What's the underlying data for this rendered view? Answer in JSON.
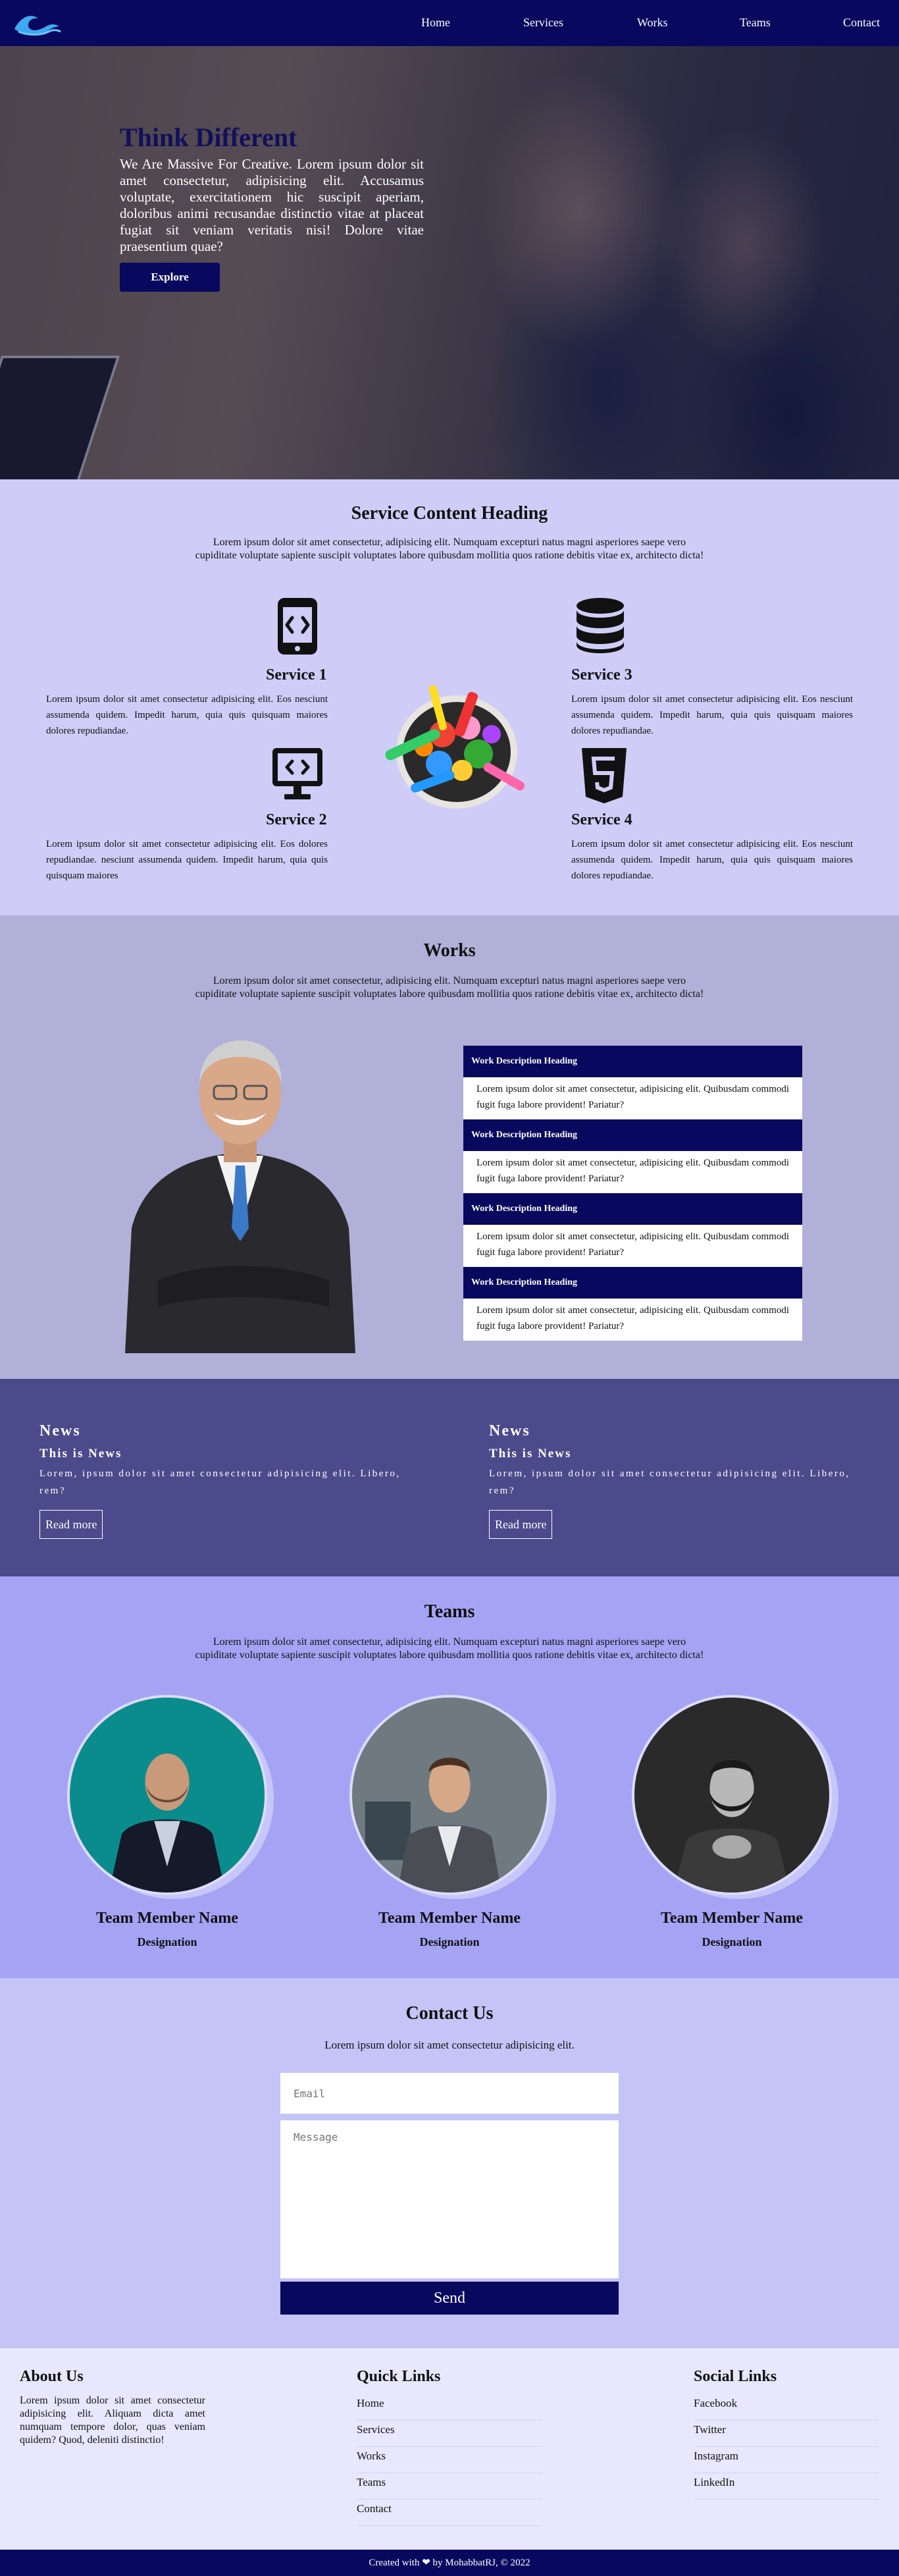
{
  "nav": {
    "items": [
      "Home",
      "Services",
      "Works",
      "Teams",
      "Contact"
    ]
  },
  "hero": {
    "title": "Think Different",
    "text": "We Are Massive For Creative. Lorem ipsum dolor sit amet consectetur, adipisicing elit. Accusamus voluptate, exercitationem hic suscipit aperiam, doloribus animi recusandae distinctio vitae at placeat fugiat sit veniam veritatis nisi! Dolore vitae praesentium quae?",
    "button": "Explore"
  },
  "services": {
    "title": "Service Content Heading",
    "subtitle": "Lorem ipsum dolor sit amet consectetur, adipisicing elit. Numquam excepturi natus magni asperiores saepe vero cupiditate voluptate sapiente suscipit voluptates labore quibusdam mollitia quos ratione debitis vitae ex, architecto dicta!",
    "items": [
      {
        "title": "Service 1",
        "text": "Lorem ipsum dolor sit amet consectetur adipisicing elit. Eos nesciunt assumenda quidem. Impedit harum, quia quis quisquam maiores dolores repudiandae.",
        "icon": "mobile-code-icon"
      },
      {
        "title": "Service 2",
        "text": "Lorem ipsum dolor sit amet consectetur adipisicing elit. Eos dolores repudiandae. nesciunt assumenda quidem. Impedit harum, quia quis quisquam maiores",
        "icon": "desktop-code-icon"
      },
      {
        "title": "Service 3",
        "text": "Lorem ipsum dolor sit amet consectetur adipisicing elit. Eos nesciunt assumenda quidem. Impedit harum, quia quis quisquam maiores dolores repudiandae.",
        "icon": "database-icon"
      },
      {
        "title": "Service 4",
        "text": "Lorem ipsum dolor sit amet consectetur adipisicing elit. Eos nesciunt assumenda quidem. Impedit harum, quia quis quisquam maiores dolores repudiandae.",
        "icon": "html5-icon"
      }
    ]
  },
  "works": {
    "title": "Works",
    "subtitle": "Lorem ipsum dolor sit amet consectetur, adipisicing elit. Numquam excepturi natus magni asperiores saepe vero cupiditate voluptate sapiente suscipit voluptates labore quibusdam mollitia quos ratione debitis vitae ex, architecto dicta!",
    "items": [
      {
        "heading": "Work Description Heading",
        "text": "Lorem ipsum dolor sit amet consectetur, adipisicing elit. Quibusdam commodi fugit fuga labore provident! Pariatur?"
      },
      {
        "heading": "Work Description Heading",
        "text": "Lorem ipsum dolor sit amet consectetur, adipisicing elit. Quibusdam commodi fugit fuga labore provident! Pariatur?"
      },
      {
        "heading": "Work Description Heading",
        "text": "Lorem ipsum dolor sit amet consectetur, adipisicing elit. Quibusdam commodi fugit fuga labore provident! Pariatur?"
      },
      {
        "heading": "Work Description Heading",
        "text": "Lorem ipsum dolor sit amet consectetur, adipisicing elit. Quibusdam commodi fugit fuga labore provident! Pariatur?"
      }
    ]
  },
  "news": [
    {
      "heading": "News",
      "subheading": "This is News",
      "text": "Lorem, ipsum dolor sit amet consectetur adipisicing elit. Libero, rem?",
      "button": "Read more"
    },
    {
      "heading": "News",
      "subheading": "This is News",
      "text": "Lorem, ipsum dolor sit amet consectetur adipisicing elit. Libero, rem?",
      "button": "Read more"
    }
  ],
  "teams": {
    "title": "Teams",
    "subtitle": "Lorem ipsum dolor sit amet consectetur, adipisicing elit. Numquam excepturi natus magni asperiores saepe vero cupiditate voluptate sapiente suscipit voluptates labore quibusdam mollitia quos ratione debitis vitae ex, architecto dicta!",
    "members": [
      {
        "name": "Team Member Name",
        "role": "Designation"
      },
      {
        "name": "Team Member Name",
        "role": "Designation"
      },
      {
        "name": "Team Member Name",
        "role": "Designation"
      }
    ]
  },
  "contact": {
    "title": "Contact Us",
    "subtitle": "Lorem ipsum dolor sit amet consectetur adipisicing elit.",
    "email_placeholder": "Email",
    "message_placeholder": "Message",
    "send": "Send"
  },
  "footer": {
    "about_title": "About Us",
    "about_text": "Lorem ipsum dolor sit amet consectetur adipisicing elit. Aliquam dicta amet numquam tempore dolor, quas veniam quidem? Quod, deleniti distinctio!",
    "quick_title": "Quick Links",
    "quick_links": [
      "Home",
      "Services",
      "Works",
      "Teams",
      "Contact"
    ],
    "social_title": "Social Links",
    "social_links": [
      "Facebook",
      "Twitter",
      "Instagram",
      "LinkedIn"
    ],
    "copy_before": "Created with",
    "copy_after": "by MohabbatRJ, © 2022"
  },
  "colors": {
    "primary": "#08085e",
    "services_bg": "#cfcdf7",
    "works_bg": "#b0b0d8",
    "news_bg": "#4b4a8a",
    "teams_bg": "#a4a3f4",
    "contact_bg": "#c5c4f7",
    "footer_bg": "#e8e7fd"
  }
}
